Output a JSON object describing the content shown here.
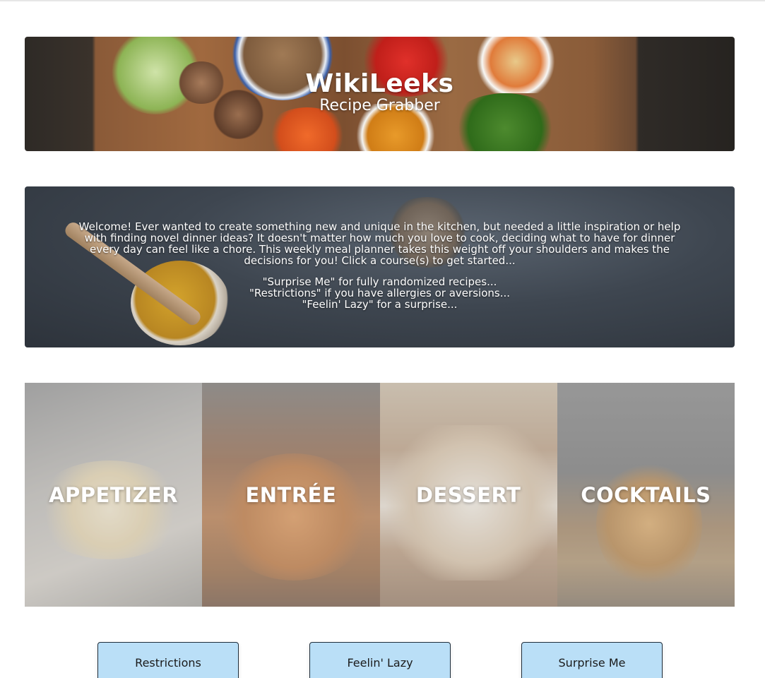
{
  "hero": {
    "title": "WikiLeeks",
    "subtitle": "Recipe Grabber"
  },
  "intro": {
    "paragraph_lines": [
      "Welcome! Ever wanted to create something new and unique in the kitchen, but needed a little inspiration or help",
      "with finding novel dinner ideas? It doesn't matter how much you love to cook, deciding what to have for dinner",
      "every day can feel like a chore. This weekly meal planner takes this weight off your shoulders and makes the",
      "decisions for you! Click a course(s) to get started..."
    ],
    "hint_lines": [
      "\"Surprise Me\" for fully randomized recipes...",
      "\"Restrictions\" if you have allergies or aversions...",
      "\"Feelin' Lazy\" for a surprise..."
    ]
  },
  "courses": [
    {
      "label": "APPETIZER"
    },
    {
      "label": "ENTRÉE"
    },
    {
      "label": "DESSERT"
    },
    {
      "label": "COCKTAILS"
    }
  ],
  "buttons": {
    "restrictions": "Restrictions",
    "feelin_lazy": "Feelin' Lazy",
    "surprise_me": "Surprise Me"
  },
  "colors": {
    "button_background": "#badff7",
    "button_border": "#1f2d3a"
  }
}
